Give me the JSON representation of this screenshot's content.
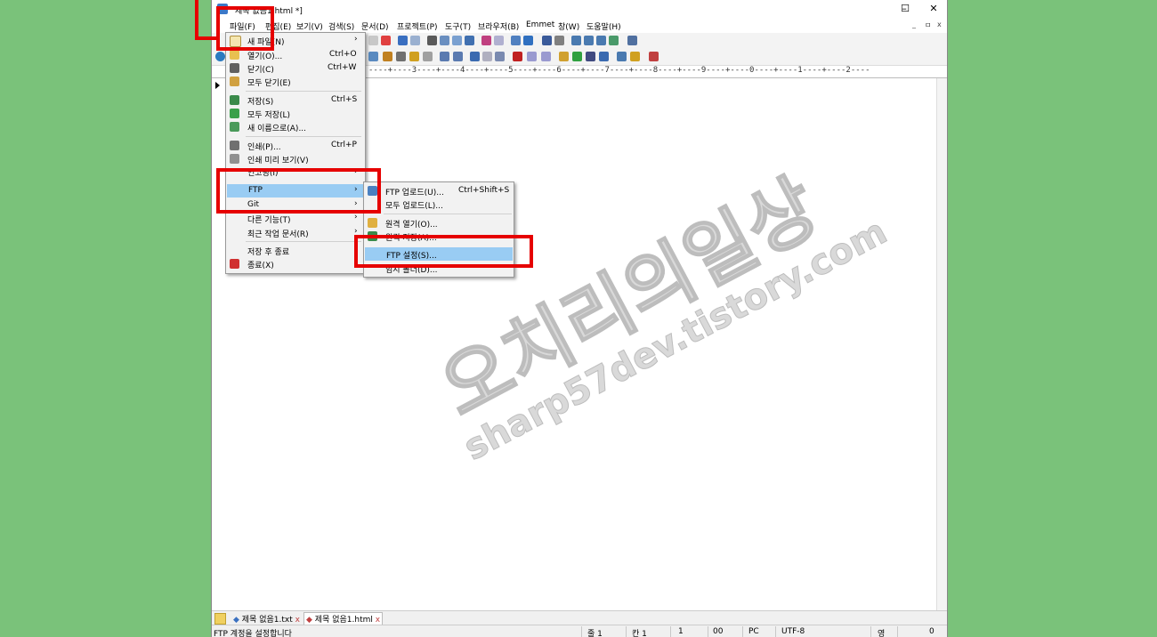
{
  "window": {
    "title": "제목 없음1.html *]",
    "controls": {
      "minimize": "–",
      "maximize": "☐",
      "close": "✕"
    }
  },
  "menubar": {
    "items": [
      "파일(F)",
      "편집(E)",
      "보기(V)",
      "검색(S)",
      "문서(D)",
      "프로젝트(P)",
      "도구(T)",
      "브라우저(B)",
      "Emmet",
      "창(W)",
      "도움말(H)"
    ],
    "mdi_controls": [
      "_",
      "ㅁ",
      "x"
    ]
  },
  "ruler": {
    "text": "----+----3----+----4----+----5----+----6----+----7----+----8----+----9----+----0----+----1----+----2----"
  },
  "file_menu": {
    "items": [
      {
        "label": "새 파일(N)",
        "shortcut": "",
        "submenu": true,
        "icon": "new-file-icon"
      },
      {
        "label": "열기(O)...",
        "shortcut": "Ctrl+O",
        "submenu": false,
        "icon": "open-folder-icon"
      },
      {
        "label": "닫기(C)",
        "shortcut": "Ctrl+W",
        "submenu": false,
        "icon": "close-file-icon"
      },
      {
        "label": "모두 닫기(E)",
        "shortcut": "",
        "submenu": false,
        "icon": "close-all-icon"
      },
      {
        "label": "저장(S)",
        "shortcut": "Ctrl+S",
        "submenu": false,
        "icon": "save-icon"
      },
      {
        "label": "모두 저장(L)",
        "shortcut": "",
        "submenu": false,
        "icon": "save-all-icon"
      },
      {
        "label": "새 이름으로(A)...",
        "shortcut": "",
        "submenu": false,
        "icon": "save-as-icon"
      },
      {
        "label": "인쇄(P)...",
        "shortcut": "Ctrl+P",
        "submenu": false,
        "icon": "print-icon"
      },
      {
        "label": "인쇄 미리 보기(V)",
        "shortcut": "",
        "submenu": false,
        "icon": "print-preview-icon"
      },
      {
        "label": "인코딩(I)",
        "shortcut": "",
        "submenu": true,
        "icon": ""
      },
      {
        "label": "FTP",
        "shortcut": "",
        "submenu": true,
        "icon": ""
      },
      {
        "label": "Git",
        "shortcut": "",
        "submenu": true,
        "icon": ""
      },
      {
        "label": "다른 기능(T)",
        "shortcut": "",
        "submenu": true,
        "icon": ""
      },
      {
        "label": "최근 작업 문서(R)",
        "shortcut": "",
        "submenu": true,
        "icon": ""
      },
      {
        "label": "저장 후 종료",
        "shortcut": "",
        "submenu": false,
        "icon": ""
      },
      {
        "label": "종료(X)",
        "shortcut": "",
        "submenu": false,
        "icon": "exit-icon"
      }
    ]
  },
  "ftp_submenu": {
    "items": [
      {
        "label": "FTP 업로드(U)...",
        "shortcut": "Ctrl+Shift+S",
        "icon": "ftp-upload-icon"
      },
      {
        "label": "모두 업로드(L)...",
        "shortcut": "",
        "icon": ""
      },
      {
        "label": "원격 열기(O)...",
        "shortcut": "",
        "icon": "remote-open-icon"
      },
      {
        "label": "원격 저장(A)...",
        "shortcut": "",
        "icon": "remote-save-icon"
      },
      {
        "label": "FTP 설정(S)...",
        "shortcut": "",
        "icon": ""
      },
      {
        "label": "임시 폴더(D)...",
        "shortcut": "",
        "icon": ""
      }
    ]
  },
  "tabs": [
    {
      "label": "제목 없음1.txt",
      "close": "x"
    },
    {
      "label": "제목 없음1.html",
      "close": "x"
    }
  ],
  "status": {
    "message": "FTP 계정을 설정합니다",
    "line": "줄 1",
    "col": "칸 1",
    "n1": "1",
    "n2": "00",
    "mode": "PC",
    "encoding": "UTF-8",
    "lang": "영",
    "count": "0"
  },
  "watermark": {
    "main": "오치리의일상",
    "sub": "sharp57dev.tistory.com"
  },
  "colors": {
    "background": "#7ac27a",
    "highlight": "#99ccf3",
    "annotation": "#e60000"
  }
}
